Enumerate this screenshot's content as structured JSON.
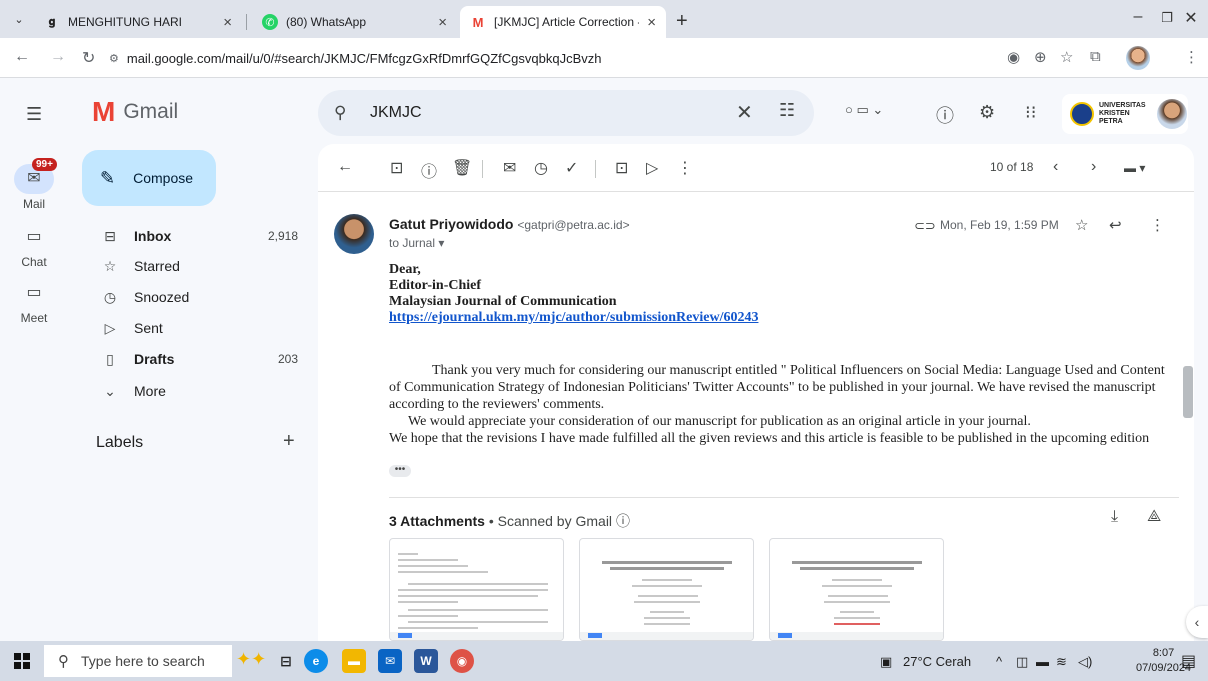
{
  "browser": {
    "tabs": [
      {
        "icon": "g",
        "title": "MENGHITUNG HARI",
        "close": "×",
        "active": false
      },
      {
        "icon": "wa",
        "title": "(80) WhatsApp",
        "close": "×",
        "active": false
      },
      {
        "icon": "M",
        "title": "[JKMJC] Article Correction - gat",
        "close": "×",
        "active": true
      }
    ],
    "new_tab": "+",
    "url": "mail.google.com/mail/u/0/#search/JKMJC/FMfcgzGxRfDmrfGQZfCgsvqbkqJcBvzh"
  },
  "gmail": {
    "brand": "Gmail",
    "rail": {
      "mail_label": "Mail",
      "mail_badge": "99+",
      "chat_label": "Chat",
      "meet_label": "Meet"
    },
    "compose_label": "Compose",
    "nav": [
      {
        "label": "Inbox",
        "count": "2,918",
        "bold": true
      },
      {
        "label": "Starred",
        "count": "",
        "bold": false
      },
      {
        "label": "Snoozed",
        "count": "",
        "bold": false
      },
      {
        "label": "Sent",
        "count": "",
        "bold": false
      },
      {
        "label": "Drafts",
        "count": "203",
        "bold": true
      },
      {
        "label": "More",
        "count": "",
        "bold": false
      }
    ],
    "labels_header": "Labels",
    "search_query": "JKMJC",
    "account_org": "UNIVERSITAS KRISTEN PETRA",
    "pager": "10 of 18"
  },
  "message": {
    "sender_name": "Gatut Priyowidodo",
    "sender_email": "<gatpri@petra.ac.id>",
    "recipients": "to Jurnal",
    "date": "Mon, Feb 19, 1:59 PM",
    "greeting": [
      "Dear,",
      "Editor-in-Chief",
      "Malaysian Journal of Communication"
    ],
    "link": "https://ejournal.ukm.my/mjc/author/submissionReview/60243",
    "paragraph1": "Thank you very much for considering our manuscript entitled \" Political Influencers on Social Media: Language Used and Content of Communication Strategy of Indonesian Politicians' Twitter Accounts\" to be published in your journal.  We have revised the manuscript according to the reviewers' comments.",
    "paragraph2": "We would appreciate your consideration of our manuscript for publication as an original article in your journal.",
    "paragraph3": "We hope that the revisions I have made fulfilled all the given reviews and this article is feasible to be published in the upcoming edition",
    "trimmed": "•••",
    "attachments_count": "3 Attachments",
    "attachments_scan": "Scanned by Gmail"
  },
  "taskbar": {
    "search_placeholder": "Type here to search",
    "weather": "27°C Cerah",
    "time": "8:07",
    "date": "07/09/2024"
  },
  "colors": {
    "gmail_red": "#ea4335",
    "compose_bg": "#c2e7ff",
    "link": "#1155cc"
  }
}
